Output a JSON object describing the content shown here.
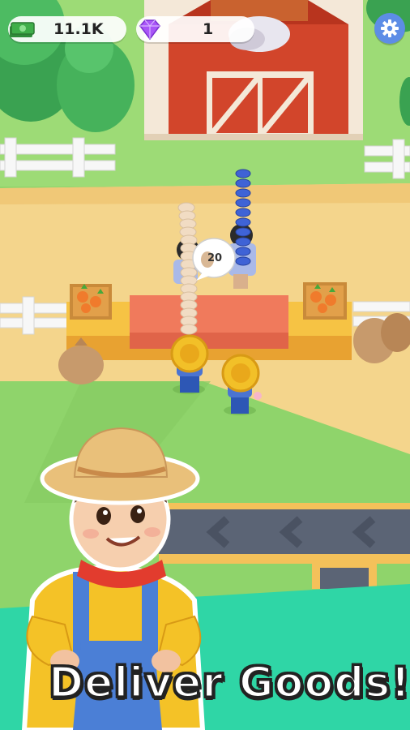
{
  "hud": {
    "cash_value": "11.1K",
    "gem_value": "1",
    "cash_icon": "cash-stack-icon",
    "gem_icon": "purple-gem-icon",
    "settings_icon": "gear-icon"
  },
  "bubble": {
    "count": "20",
    "icon": "egg-icon"
  },
  "banner": {
    "title": "Deliver Goods!"
  },
  "colors": {
    "grass": "#8fd46b",
    "dirt_path": "#f4d58c",
    "barn_red": "#d2452b",
    "banner_teal": "#2fd6a6",
    "gear_blue": "#5d8de6",
    "gem_purple": "#a855f7",
    "cash_green": "#3fae4a"
  }
}
